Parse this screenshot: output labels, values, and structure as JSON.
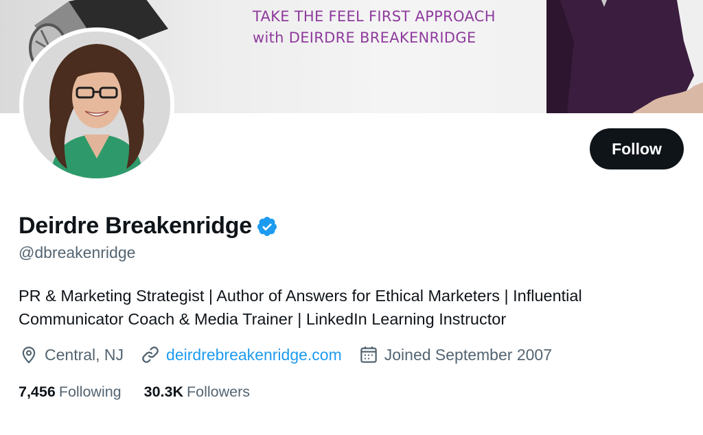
{
  "banner": {
    "headline_line1": "TAKE THE FEEL FIRST APPROACH",
    "headline_line2": "with DEIRDRE BREAKENRIDGE",
    "accent_color": "#8e3a9d"
  },
  "profile": {
    "display_name": "Deirdre Breakenridge",
    "verified": true,
    "handle": "@dbreakenridge",
    "bio_line1": "PR & Marketing Strategist | Author of Answers for Ethical Marketers | Influential",
    "bio_line2": "Communicator Coach & Media Trainer | LinkedIn Learning Instructor",
    "location": "Central, NJ",
    "website": "deirdrebreakenridge.com",
    "joined": "Joined September 2007"
  },
  "actions": {
    "follow_label": "Follow"
  },
  "stats": {
    "following_count": "7,456",
    "following_label": "Following",
    "followers_count": "30.3K",
    "followers_label": "Followers"
  },
  "icons": {
    "verified": "verified-badge-icon",
    "location": "location-pin-icon",
    "website": "link-icon",
    "joined": "calendar-icon"
  },
  "colors": {
    "primary_text": "#0f1419",
    "secondary_text": "#536471",
    "link": "#1d9bf0",
    "verified": "#1d9bf0",
    "button_bg": "#0f1419"
  }
}
